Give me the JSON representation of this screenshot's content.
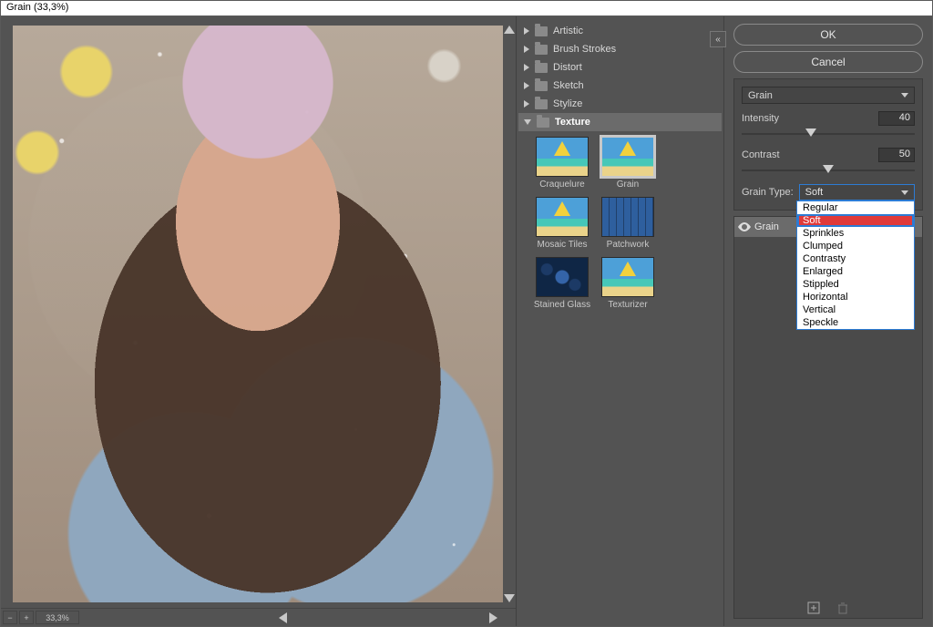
{
  "title": "Grain (33,3%)",
  "zoom": "33,3%",
  "categories": {
    "artistic": "Artistic",
    "brush": "Brush Strokes",
    "distort": "Distort",
    "sketch": "Sketch",
    "stylize": "Stylize",
    "texture": "Texture"
  },
  "thumbs": {
    "craquelure": "Craquelure",
    "grain": "Grain",
    "mosaic": "Mosaic Tiles",
    "patchwork": "Patchwork",
    "glass": "Stained Glass",
    "texturizer": "Texturizer"
  },
  "buttons": {
    "ok": "OK",
    "cancel": "Cancel"
  },
  "filter": {
    "name": "Grain",
    "intensity": {
      "label": "Intensity",
      "value": "40"
    },
    "contrast": {
      "label": "Contrast",
      "value": "50"
    },
    "type_label": "Grain Type:",
    "type_value": "Soft",
    "options": {
      "regular": "Regular",
      "soft": "Soft",
      "sprinkles": "Sprinkles",
      "clumped": "Clumped",
      "contrasty": "Contrasty",
      "enlarged": "Enlarged",
      "stippled": "Stippled",
      "horizontal": "Horizontal",
      "vertical": "Vertical",
      "speckle": "Speckle"
    }
  },
  "layer": "Grain"
}
